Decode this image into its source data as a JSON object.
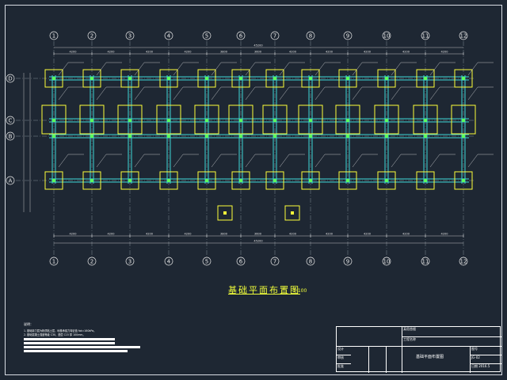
{
  "drawing": {
    "title": "基础平面布置图",
    "scale": "1:100",
    "overall_dimension": "45200",
    "grid_columns": [
      "1",
      "2",
      "3",
      "4",
      "5",
      "6",
      "7",
      "8",
      "9",
      "10",
      "11",
      "12"
    ],
    "grid_rows": [
      "D",
      "C",
      "B",
      "A"
    ],
    "bay_dimensions": [
      "4200",
      "4200",
      "4200",
      "4200",
      "3800",
      "3600",
      "4200",
      "4200",
      "4200",
      "4200",
      "4200"
    ],
    "footing_labels": [
      "J-1",
      "J-2",
      "J-3"
    ],
    "elevation_label": "-1.600"
  },
  "notes": {
    "heading": "说明：",
    "lines": [
      "1. 基础持力层为粉质粘土层，地基承载力特征值 fak=160kPa。",
      "2. 基础混凝土强度等级 C30，垫层 C15 厚 100mm。"
    ]
  },
  "title_block": {
    "project": "某宿舍楼",
    "subproject": "工程名称",
    "drawing_name": "基础平面布置图",
    "fields": [
      "设计",
      "审核",
      "批准"
    ],
    "right_fields": [
      "图号",
      "JG-02",
      "日期"
    ],
    "date": "2016.5"
  },
  "colors": {
    "background": "#1e2733",
    "beam": "#3fd7d7",
    "footing": "#ffff3a",
    "axis": "#9aa3ad",
    "dimension": "#e6e6e6",
    "column": "#5cff5c"
  }
}
